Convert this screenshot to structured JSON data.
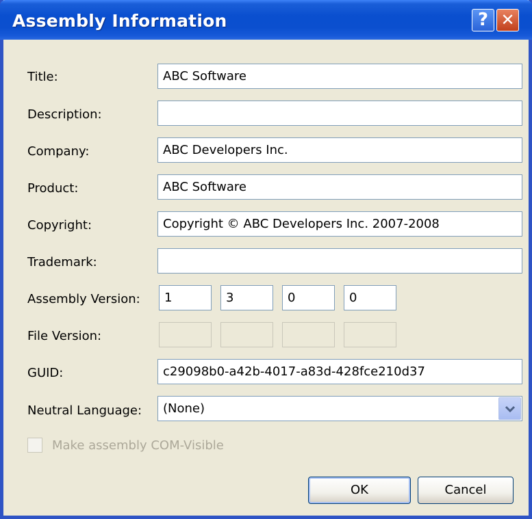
{
  "window": {
    "title": "Assembly Information",
    "help_glyph": "?",
    "close_glyph": "✕"
  },
  "labels": {
    "title": "Title:",
    "description": "Description:",
    "company": "Company:",
    "product": "Product:",
    "copyright": "Copyright:",
    "trademark": "Trademark:",
    "assembly_version": "Assembly Version:",
    "file_version": "File Version:",
    "guid": "GUID:",
    "neutral_language": "Neutral Language:"
  },
  "fields": {
    "title": "ABC Software",
    "description": "",
    "company": "ABC Developers Inc.",
    "product": "ABC Software",
    "copyright": "Copyright © ABC Developers Inc. 2007-2008",
    "trademark": "",
    "assembly_version": [
      "1",
      "3",
      "0",
      "0"
    ],
    "file_version": [
      "",
      "",
      "",
      ""
    ],
    "guid": "c29098b0-a42b-4017-a83d-428fce210d37",
    "neutral_language": "(None)"
  },
  "checkbox": {
    "label": "Make assembly COM-Visible",
    "checked": false,
    "enabled": false
  },
  "buttons": {
    "ok": "OK",
    "cancel": "Cancel"
  },
  "icons": {
    "help": "help-icon",
    "close": "close-icon",
    "combo_arrow": "chevron-down-icon"
  },
  "colors": {
    "titlebar": "#0a4fcf",
    "dialog_bg": "#ece9d8",
    "close_button": "#c1401c"
  }
}
